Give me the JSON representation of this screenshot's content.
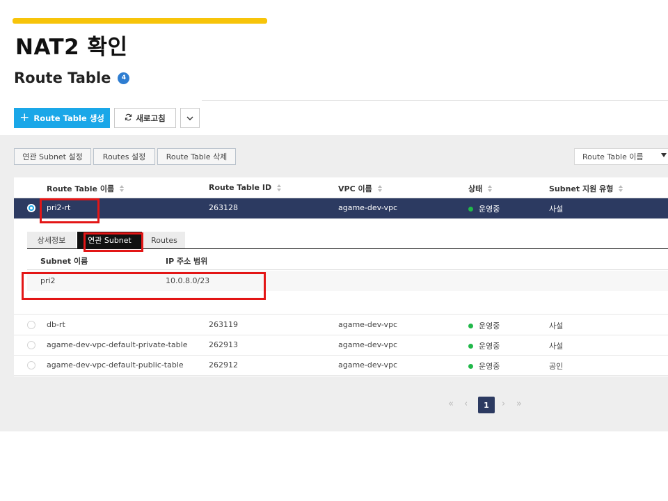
{
  "slide": {
    "title": "NAT2 확인"
  },
  "page": {
    "title": "Route Table",
    "count": "4"
  },
  "toolbar": {
    "create_label": "Route Table 생성",
    "refresh_label": "새로고침"
  },
  "actions": {
    "assoc_subnet": "연관 Subnet 설정",
    "routes": "Routes 설정",
    "delete": "Route Table 삭제"
  },
  "search": {
    "field": "Route Table 이름"
  },
  "table": {
    "headers": [
      "Route Table 이름",
      "Route Table ID",
      "VPC 이름",
      "상태",
      "Subnet 지원 유형"
    ],
    "rows": [
      {
        "name": "pri2-rt",
        "id": "263128",
        "vpc": "agame-dev-vpc",
        "status": "운영중",
        "type": "사설",
        "selected": true
      },
      {
        "name": "db-rt",
        "id": "263119",
        "vpc": "agame-dev-vpc",
        "status": "운영중",
        "type": "사설",
        "selected": false
      },
      {
        "name": "agame-dev-vpc-default-private-table",
        "id": "262913",
        "vpc": "agame-dev-vpc",
        "status": "운영중",
        "type": "사설",
        "selected": false
      },
      {
        "name": "agame-dev-vpc-default-public-table",
        "id": "262912",
        "vpc": "agame-dev-vpc",
        "status": "운영중",
        "type": "공인",
        "selected": false
      }
    ]
  },
  "detail": {
    "tabs": [
      "상세정보",
      "연관 Subnet",
      "Routes"
    ],
    "active_tab": "연관 Subnet",
    "headers": [
      "Subnet 이름",
      "IP 주소 범위"
    ],
    "rows": [
      {
        "subnet": "pri2",
        "ip_range": "10.0.8.0/23"
      }
    ]
  },
  "pagination": {
    "current": "1"
  },
  "colors": {
    "accent": "#f7c40a",
    "primary": "#1aa7e8",
    "selected_row": "#2c3a61",
    "highlight": "#e31616",
    "status_ok": "#21b84a"
  }
}
